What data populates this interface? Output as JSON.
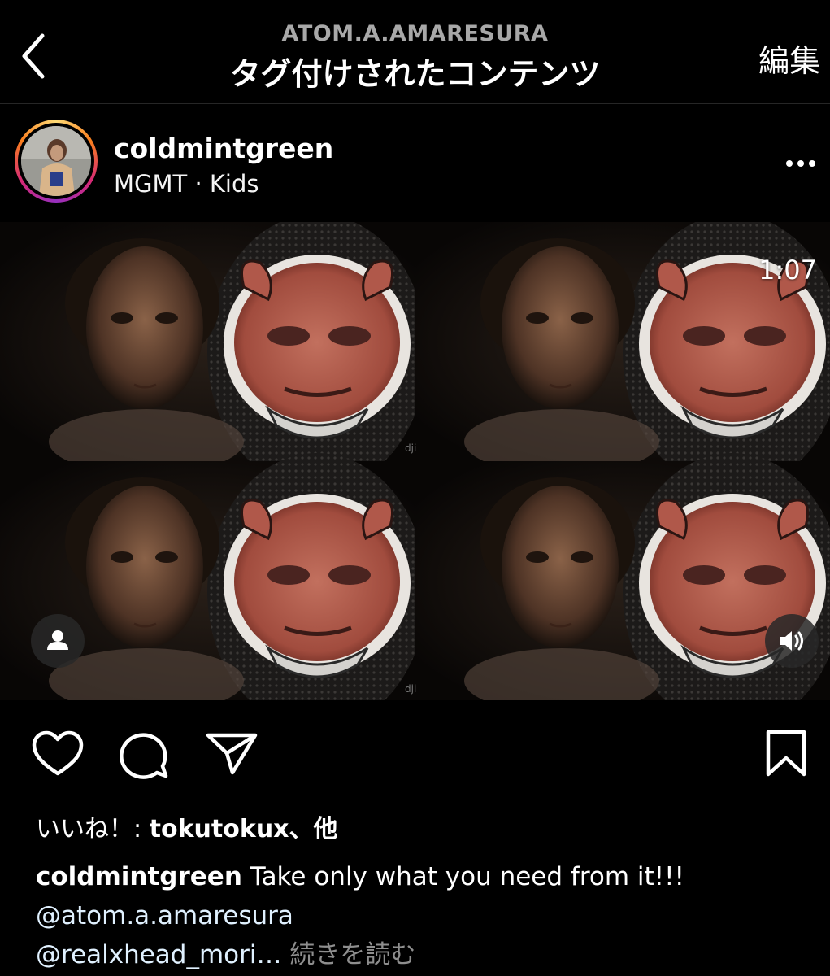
{
  "header": {
    "account": "ATOM.A.AMARESURA",
    "title": "タグ付けされたコンテンツ",
    "edit_label": "編集"
  },
  "post": {
    "username": "coldmintgreen",
    "music": "MGMT · Kids",
    "video_duration": "1:07",
    "likes_prefix": "いいね！: ",
    "likes_user": "tokutokux",
    "likes_suffix": "、他",
    "caption": {
      "username": "coldmintgreen",
      "text": " Take only what you need from it!!!",
      "mention1": "@atom.a.amaresura",
      "mention2": "@realxhead_mori…",
      "more_label": " 続きを読む"
    }
  },
  "colors": {
    "background": "#000000",
    "secondary_text": "#a8a8a8",
    "divider": "#262626",
    "muted_link": "#8e8e8e"
  },
  "icons": {
    "back": "chevron-left-icon",
    "more": "more-horizontal-icon",
    "tag": "person-tag-icon",
    "sound": "speaker-icon",
    "like": "heart-icon",
    "comment": "comment-icon",
    "share": "send-icon",
    "save": "bookmark-icon"
  }
}
